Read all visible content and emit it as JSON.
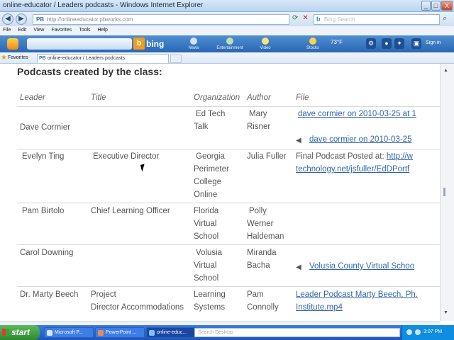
{
  "window": {
    "title": "online-educator / Leaders podcasts - Windows Internet Explorer",
    "min": "_",
    "max": "□",
    "close": "X"
  },
  "address_bar": {
    "back": "◀",
    "forward": "▶",
    "url_prefix": "PB",
    "url": "http://onlineeducator.pbworks.com",
    "search_placeholder": "Bing Search",
    "search_brand": "b"
  },
  "menu": [
    "File",
    "Edit",
    "View",
    "Favorites",
    "Tools",
    "Help"
  ],
  "bing_toolbar": {
    "brand_letter": "b",
    "brand_word": "bing",
    "items": [
      "News",
      "Entertainment",
      "Video",
      "Stocks"
    ],
    "temperature": "73°F",
    "sign_in": "Sign in"
  },
  "favorites_bar": {
    "label": "Favorites",
    "tab_prefix": "PB",
    "tab_title": "online-educator / Leaders podcasts"
  },
  "page": {
    "heading": "Podcasts created by the class:",
    "columns": [
      "Leader",
      "Title",
      "Organization",
      "Author",
      "File"
    ],
    "rows": [
      {
        "leader": "Dave Cormier",
        "title": "",
        "organization": [
          "Ed Tech",
          "Talk"
        ],
        "author": [
          "Mary",
          "Risner"
        ],
        "file_link_1": "dave cormier on 2010-03-25 at 1",
        "file_link_2": "dave cormier on 2010-03-25"
      },
      {
        "leader": "Evelyn Ting",
        "title": "Executive Director",
        "organization": [
          "Georgia",
          "Perimeter",
          "College",
          "Online"
        ],
        "author": [
          "Julia Fuller"
        ],
        "file_text": "Final Podcast Posted at: ",
        "file_link_1": "http://w",
        "file_link_2": "technology.net/jsfuller/EdDPortf"
      },
      {
        "leader": "Pam Birtolo",
        "title": "Chief Learning Officer",
        "organization": [
          "Florida",
          "Virtual",
          "School"
        ],
        "author": [
          "Polly",
          "Werner",
          "Haldeman"
        ]
      },
      {
        "leader": "Carol Downing",
        "title": "",
        "organization": [
          "Volusia",
          "Virtual",
          "School"
        ],
        "author": [
          "Miranda",
          "Bacha"
        ],
        "file_link_1": "Volusia County Virtual Schoo"
      },
      {
        "leader": "Dr. Marty Beech",
        "title": [
          "Project",
          "Director Accommodations"
        ],
        "organization": [
          "Learning",
          "Systems"
        ],
        "author": [
          "Pam",
          "Connolly"
        ],
        "file_link_1": "Leader Podcast Marty Beech, Ph.",
        "file_link_2": "Institute.mp4"
      }
    ]
  },
  "taskbar": {
    "start": "start",
    "tasks": [
      "Microsoft P...",
      "PowerPoint ...",
      "online-educ..."
    ],
    "search_placeholder": "Search Desktop",
    "clock": "3:07 PM"
  }
}
